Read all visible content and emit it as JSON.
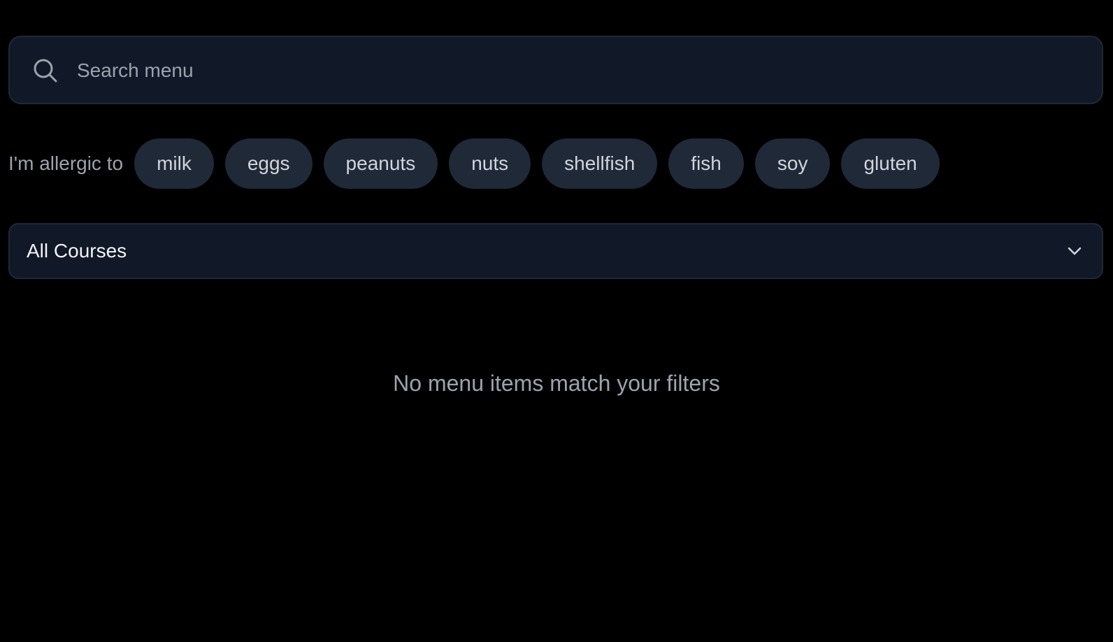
{
  "search": {
    "placeholder": "Search menu",
    "value": "",
    "icon": "search-icon"
  },
  "allergens": {
    "label": "I'm allergic to",
    "items": [
      {
        "label": "milk"
      },
      {
        "label": "eggs"
      },
      {
        "label": "peanuts"
      },
      {
        "label": "nuts"
      },
      {
        "label": "shellfish"
      },
      {
        "label": "fish"
      },
      {
        "label": "soy"
      },
      {
        "label": "gluten"
      }
    ]
  },
  "course_filter": {
    "selected": "All Courses",
    "icon": "chevron-down-icon"
  },
  "empty_state": {
    "message": "No menu items match your filters"
  },
  "colors": {
    "background": "#000000",
    "surface": "#111827",
    "chip": "#1f2937",
    "muted_text": "#9ca3af"
  }
}
